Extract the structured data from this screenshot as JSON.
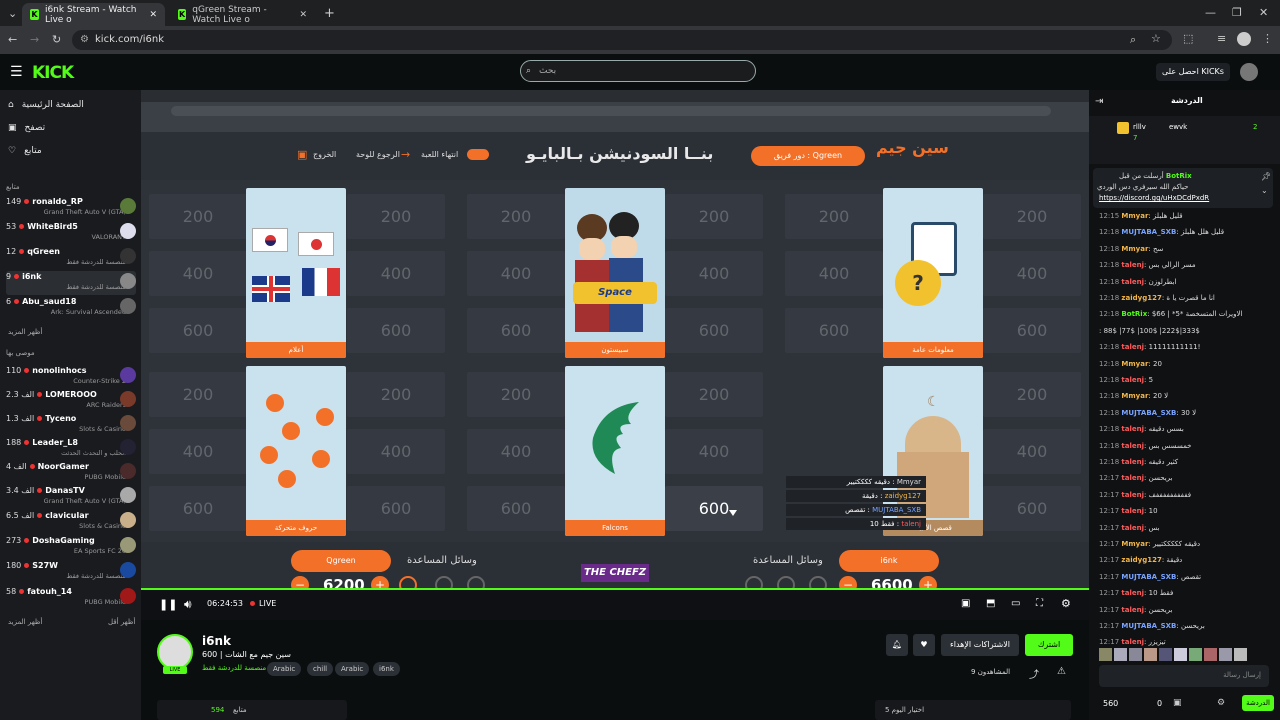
{
  "browser": {
    "tabs": [
      {
        "title": "i6nk Stream - Watch Live o"
      },
      {
        "title": "qGreen Stream - Watch Live o"
      }
    ],
    "url": "kick.com/i6nk"
  },
  "header": {
    "logo": "KICK",
    "search_placeholder": "بحث",
    "get_kicks": "احصل على KICKs"
  },
  "sidebar": {
    "nav": [
      {
        "label": "الصفحة الرئيسية",
        "icon": "home-icon"
      },
      {
        "label": "تصفح",
        "icon": "browse-icon"
      },
      {
        "label": "متابع",
        "icon": "heart-icon"
      }
    ],
    "followed_header": "متابع",
    "followed": [
      {
        "viewers": "149",
        "name": "ronaldo_RP",
        "game": "Grand Theft Auto V (GTA)"
      },
      {
        "viewers": "53",
        "name": "WhiteBird5",
        "game": "VALORANT"
      },
      {
        "viewers": "12",
        "name": "qGreen",
        "game": "منصسة للدردشة فقط"
      },
      {
        "viewers": "9",
        "name": "i6nk",
        "game": "منصسة للدردشة فقط"
      },
      {
        "viewers": "6",
        "name": "Abu_saud18",
        "game": "Ark: Survival Ascended"
      }
    ],
    "show_more_1": "أظهر المزيد",
    "recommended_header": "موصى بها",
    "recommended": [
      {
        "viewers": "110",
        "name": "nonolinhocs",
        "game": "Counter-Strike 2"
      },
      {
        "viewers": "2.3 الف",
        "name": "LOMEROOO",
        "game": "ARC Raiders"
      },
      {
        "viewers": "1.3 الف",
        "name": "Tyceno",
        "game": "Slots & Casino"
      },
      {
        "viewers": "188",
        "name": "Leader_L8",
        "game": "الحلب و التحدث الحدثت"
      },
      {
        "viewers": "4 الف",
        "name": "NoorGamer",
        "game": "PUBG Mobile"
      },
      {
        "viewers": "3.4 الف",
        "name": "DanasTV",
        "game": "Grand Theft Auto V (GTA)"
      },
      {
        "viewers": "6.5 الف",
        "name": "clavicular",
        "game": "Slots & Casino"
      },
      {
        "viewers": "273",
        "name": "DoshaGaming",
        "game": "EA Sports FC 26"
      },
      {
        "viewers": "180",
        "name": "S27W",
        "game": "منصسة للدردشة فقط"
      },
      {
        "viewers": "58",
        "name": "fatouh_14",
        "game": "PUBG Mobile"
      }
    ],
    "show_more_2": "أظهر المزيد",
    "show_less": "أظهر أقل"
  },
  "game": {
    "team_label": "دور فريق : Qgreen",
    "title_text": "بنــا السودنيشن بـالبايـو",
    "controls": [
      "انتهاء اللعبة",
      "الرجوع للوحة",
      "الخروج"
    ],
    "categories": [
      {
        "label": "أعلام"
      },
      {
        "label": "سبيستون"
      },
      {
        "label": "معلومات عامة"
      },
      {
        "label": "حروف متحركة"
      },
      {
        "label": "Falcons"
      },
      {
        "label": "قصص الأنبياء"
      }
    ],
    "points": [
      "200",
      "400",
      "600"
    ],
    "hover_value": "600",
    "team_left": {
      "name": "Qgreen",
      "score": "6200",
      "help_label": "وسائل المساعدة"
    },
    "team_right": {
      "name": "i6nk",
      "score": "6600",
      "help_label": "وسائل المساعدة"
    },
    "sponsor": "THE CHEFZ"
  },
  "overlay_chat": [
    {
      "user": "Mmyar",
      "text": "دقيقه ككككتيير"
    },
    {
      "user": "zaidyg127",
      "text": "دقيقة"
    },
    {
      "user": "MUJTABA_SXB",
      "text": "تقصص"
    },
    {
      "user": "talenj",
      "text": "فقط 10"
    }
  ],
  "player": {
    "time": "06:24:53",
    "live": "LIVE"
  },
  "stream": {
    "streamer": "i6nk",
    "title": "سين جيم مع الشات | 600",
    "category": "منصسة للدردشة فقط",
    "tags": [
      "Arabic",
      "chill",
      "Arabic",
      "i6nk"
    ],
    "viewers": "المشاهدون 9",
    "subscribe": "اشترك",
    "gift": "الاشتراكات الإهداء",
    "followers_label": "متابع",
    "followers_count": "594",
    "top5": "اختيار اليوم 5"
  },
  "chat": {
    "title": "الدردشة",
    "top_gifters": [
      {
        "name": "rlllv",
        "count": "7"
      },
      {
        "name": "ewvk",
        "count": "2"
      }
    ],
    "pinned_by": "أرسلت من قبل",
    "pinned_user": "BotRix",
    "pinned_text": "حياكم الله سيرفري دس الوردي",
    "pinned_link": "https://discord.gg/uHxDCdPxdR",
    "messages": [
      {
        "time": "12:15",
        "user": "Mmyar",
        "text": "قليل هلبلز",
        "color": "#f3b64a"
      },
      {
        "time": "12:18",
        "user": "MUJTABA_SXB",
        "text": "قليل هلل هلبلز",
        "color": "#7aa4ff"
      },
      {
        "time": "12:18",
        "user": "Mmyar",
        "text": "سح",
        "color": "#f3b64a"
      },
      {
        "time": "12:18",
        "user": "talenj",
        "text": "مسر الرالي بس",
        "color": "#ff5b5b"
      },
      {
        "time": "12:18",
        "user": "talenj",
        "text": "ابطرلوزن",
        "color": "#ff5b5b"
      },
      {
        "time": "12:18",
        "user": "zaidyg127",
        "text": "انا ما قصرت يا ة",
        "color": "#f3b64a"
      },
      {
        "time": "12:18",
        "user": "BotRix",
        "text": "$66 | *5* الاويرات المتسخصة",
        "color": "#53fc18"
      },
      {
        "time": "",
        "user": "",
        "text": "88$ |77$ |100$ |222$|333$",
        "color": "#ddd"
      },
      {
        "time": "12:18",
        "user": "talenj",
        "text": "11111111111!",
        "color": "#ff5b5b"
      },
      {
        "time": "12:18",
        "user": "Mmyar",
        "text": "20",
        "color": "#f3b64a"
      },
      {
        "time": "12:18",
        "user": "talenj",
        "text": "5",
        "color": "#ff5b5b"
      },
      {
        "time": "12:18",
        "user": "Mmyar",
        "text": "20 لا",
        "color": "#f3b64a"
      },
      {
        "time": "12:18",
        "user": "MUJTABA_SXB",
        "text": "30 لا",
        "color": "#7aa4ff"
      },
      {
        "time": "12:18",
        "user": "talenj",
        "text": "بسس دقيقه",
        "color": "#ff5b5b"
      },
      {
        "time": "12:18",
        "user": "talenj",
        "text": "خمسسس بس",
        "color": "#ff5b5b"
      },
      {
        "time": "12:18",
        "user": "talenj",
        "text": "كثير دقيقه",
        "color": "#ff5b5b"
      },
      {
        "time": "12:17",
        "user": "talenj",
        "text": "بريحسن",
        "color": "#ff5b5b"
      },
      {
        "time": "12:17",
        "user": "talenj",
        "text": "ففففففففففف",
        "color": "#ff5b5b"
      },
      {
        "time": "12:17",
        "user": "talenj",
        "text": "10",
        "color": "#ff5b5b"
      },
      {
        "time": "12:17",
        "user": "talenj",
        "text": "بس",
        "color": "#ff5b5b"
      },
      {
        "time": "12:17",
        "user": "Mmyar",
        "text": "دقيقه كككككتيير",
        "color": "#f3b64a"
      },
      {
        "time": "12:17",
        "user": "zaidyg127",
        "text": "دقيقة",
        "color": "#f3b64a"
      },
      {
        "time": "12:17",
        "user": "MUJTABA_SXB",
        "text": "تقصص",
        "color": "#7aa4ff"
      },
      {
        "time": "12:17",
        "user": "talenj",
        "text": "فقط 10",
        "color": "#ff5b5b"
      },
      {
        "time": "12:17",
        "user": "talenj",
        "text": "بريحسن",
        "color": "#ff5b5b"
      },
      {
        "time": "12:17",
        "user": "MUJTABA_SXB",
        "text": "بريحسن",
        "color": "#7aa4ff"
      },
      {
        "time": "12:17",
        "user": "talenj",
        "text": "تيزيزر",
        "color": "#ff5b5b"
      }
    ],
    "input_placeholder": "إرسال رسالة",
    "kicks": "560",
    "count": "0",
    "send": "الدردشة"
  }
}
